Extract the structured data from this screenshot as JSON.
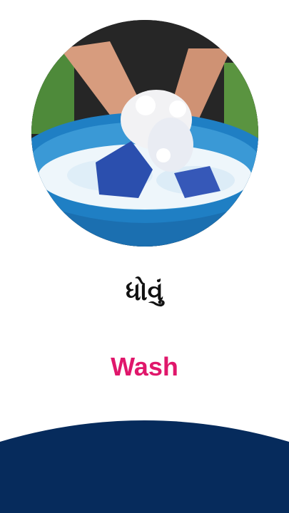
{
  "card": {
    "native_word": "ધોવું",
    "english_word": "Wash",
    "image_subject": "hands-washing-clothes-in-tub"
  },
  "colors": {
    "english_word": "#e0176b",
    "bottom_wave": "#062b5c",
    "background": "#ffffff"
  }
}
